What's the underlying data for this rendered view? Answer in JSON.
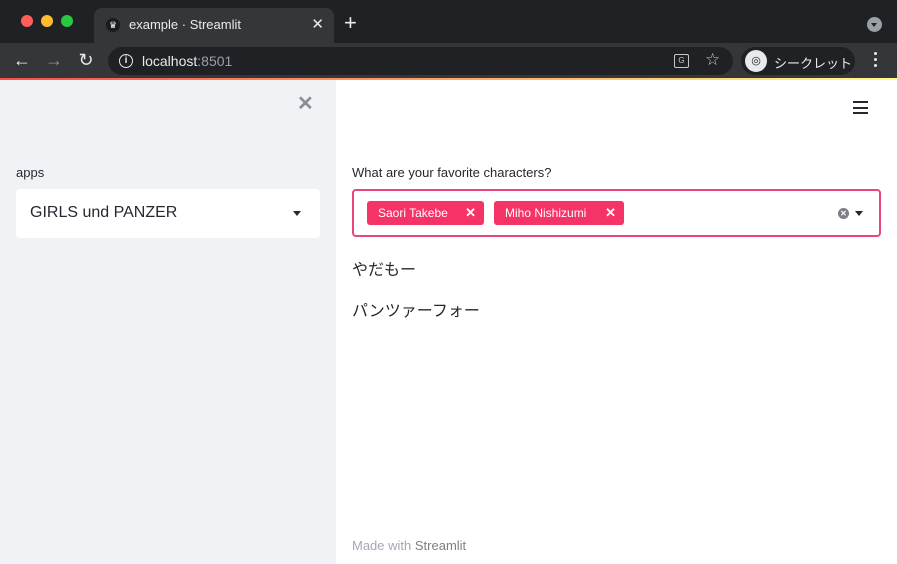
{
  "browser": {
    "tab_title": "example · Streamlit",
    "tab_favicon": "♛",
    "new_tab": "+",
    "tab_close": "✕",
    "url_host": "localhost",
    "url_port": ":8501",
    "incognito_label": "シークレット",
    "icons": [
      "back-arrow-icon",
      "forward-arrow-icon",
      "reload-icon",
      "info-icon",
      "translate-icon",
      "star-icon",
      "incognito-icon",
      "kebab-menu-icon"
    ]
  },
  "sidebar": {
    "close_glyph": "✕",
    "select_label": "apps",
    "select_value": "GIRLS und PANZER"
  },
  "main": {
    "multiselect_label": "What are your favorite characters?",
    "selected": [
      {
        "label": "Saori Takebe",
        "remove": "✕"
      },
      {
        "label": "Miho Nishizumi",
        "remove": "✕"
      }
    ],
    "clear_glyph": "✕",
    "outputs": [
      "やだもー",
      "パンツァーフォー"
    ]
  },
  "footer": {
    "prefix": "Made with ",
    "link": "Streamlit"
  },
  "colors": {
    "accent": "#f63366",
    "focus_border": "#e8467c",
    "sidebar_bg": "#f0f2f6",
    "chrome_dark": "#202124",
    "chrome_toolbar": "#35363a"
  }
}
